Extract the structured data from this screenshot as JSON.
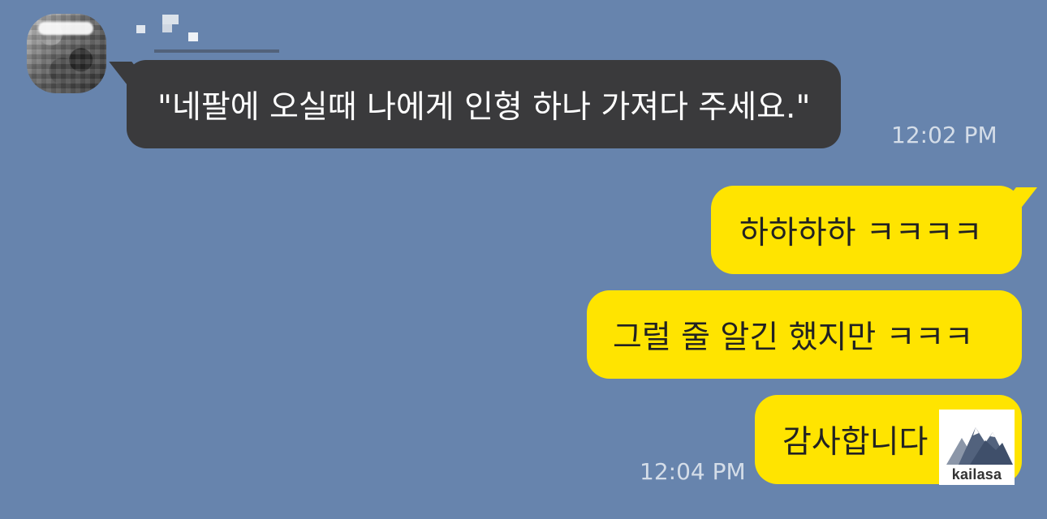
{
  "messages": {
    "incoming": {
      "text": "\"네팔에 오실때 나에게 인형 하나 가져다 주세요.\"",
      "time": "12:02 PM"
    },
    "outgoing": [
      {
        "text": "하하하하 ㅋㅋㅋㅋ"
      },
      {
        "text": "그럴 줄 알긴 했지만 ㅋㅋㅋ"
      },
      {
        "text": "감사합니다"
      }
    ],
    "last_time": "12:04 PM"
  },
  "watermark": {
    "label": "kailasa",
    "icon": "mountain-logo-icon"
  },
  "colors": {
    "background": "#6784ad",
    "incoming_bubble": "#3a3a3c",
    "outgoing_bubble": "#ffe400",
    "incoming_text": "#ffffff",
    "outgoing_text": "#222222",
    "time_text": "#e6ebf4"
  }
}
